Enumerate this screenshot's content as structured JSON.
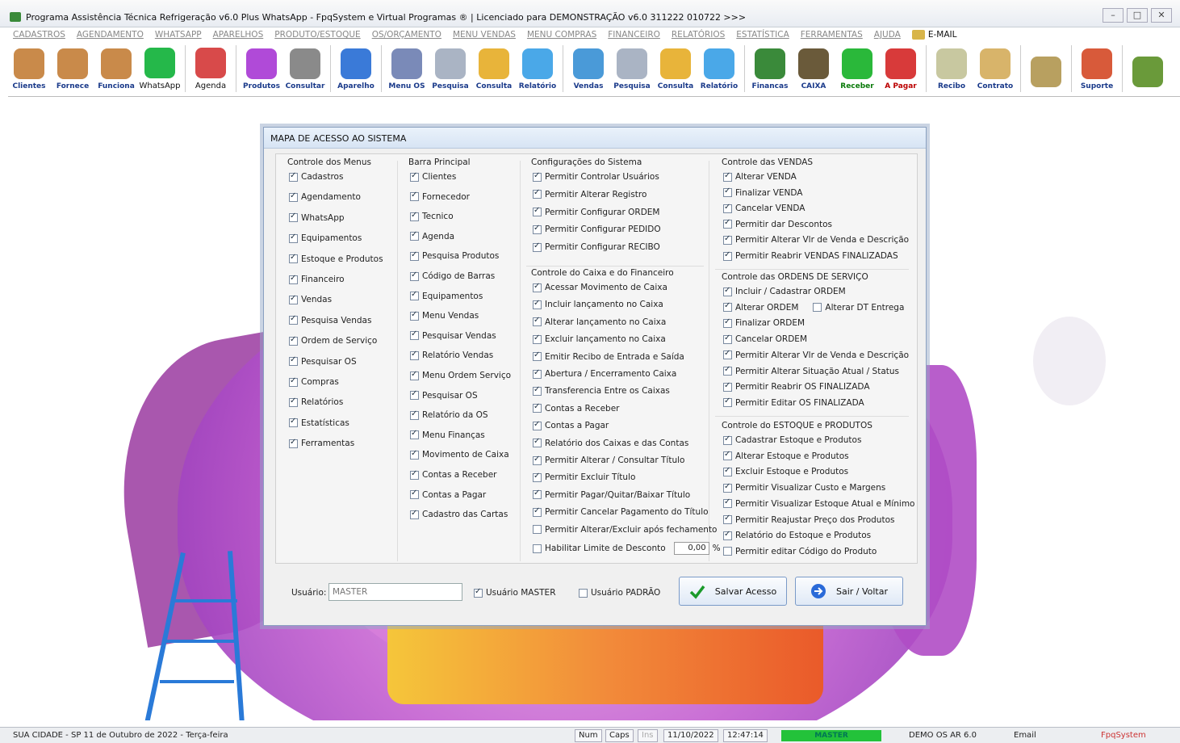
{
  "window": {
    "title": "Programa Assistência Técnica Refrigeração v6.0 Plus WhatsApp - FpqSystem e Virtual Programas ® | Licenciado para  DEMONSTRAÇÃO v6.0 311222 010722 >>>",
    "controls": [
      "–",
      "□",
      "✕"
    ]
  },
  "menu": [
    "CADASTROS",
    "AGENDAMENTO",
    "WHATSAPP",
    "APARELHOS",
    "PRODUTO/ESTOQUE",
    "OS/ORÇAMENTO",
    "MENU VENDAS",
    "MENU COMPRAS",
    "FINANCEIRO",
    "RELATÓRIOS",
    "ESTATÍSTICA",
    "FERRAMENTAS",
    "AJUDA"
  ],
  "menu_email": "E-MAIL",
  "toolbar": [
    {
      "label": "Clientes",
      "icon": "clients-icon",
      "color": "#c98a4a"
    },
    {
      "label": "Fornece",
      "icon": "supplier-icon",
      "color": "#c98a4a"
    },
    {
      "label": "Funciona",
      "icon": "employees-icon",
      "color": "#c98a4a"
    },
    {
      "label": "WhatsApp",
      "icon": "whatsapp-icon",
      "color": "#25b84a"
    },
    {
      "label": "Agenda",
      "icon": "calendar-icon",
      "color": "#d84a4a"
    },
    {
      "label": "Produtos",
      "icon": "products-icon",
      "color": "#b04ad8"
    },
    {
      "label": "Consultar",
      "icon": "barcode-icon",
      "color": "#8a8a8a"
    },
    {
      "label": "Aparelho",
      "icon": "device-icon",
      "color": "#3a7ad8"
    },
    {
      "label": "Menu OS",
      "icon": "tools-icon",
      "color": "#7a8ab8"
    },
    {
      "label": "Pesquisa",
      "icon": "search-doc-icon",
      "color": "#aab4c4"
    },
    {
      "label": "Consulta",
      "icon": "folder-icon",
      "color": "#e8b43a"
    },
    {
      "label": "Relatório",
      "icon": "report-icon",
      "color": "#4aa8e8"
    },
    {
      "label": "Vendas",
      "icon": "monitor-icon",
      "color": "#4a9ad8"
    },
    {
      "label": "Pesquisa",
      "icon": "search-doc-icon",
      "color": "#aab4c4"
    },
    {
      "label": "Consulta",
      "icon": "folder-icon",
      "color": "#e8b43a"
    },
    {
      "label": "Relatório",
      "icon": "report-icon",
      "color": "#4aa8e8"
    },
    {
      "label": "Financas",
      "icon": "finance-icon",
      "color": "#3a8a3a"
    },
    {
      "label": "CAIXA",
      "icon": "cashbox-icon",
      "color": "#6a5a3a"
    },
    {
      "label": "Receber",
      "icon": "receive-icon",
      "color": "#2ab83a"
    },
    {
      "label": "A Pagar",
      "icon": "pay-icon",
      "color": "#d83a3a"
    },
    {
      "label": "Recibo",
      "icon": "receipt-icon",
      "color": "#c8c8a0"
    },
    {
      "label": "Contrato",
      "icon": "contract-icon",
      "color": "#d8b46a"
    },
    {
      "label": "",
      "icon": "coins-icon",
      "color": "#b8a060"
    },
    {
      "label": "Suporte",
      "icon": "support-icon",
      "color": "#d85a3a"
    },
    {
      "label": "",
      "icon": "exit-icon",
      "color": "#6a9a3a"
    }
  ],
  "dialog": {
    "title": "MAPA DE ACESSO AO SISTEMA",
    "menus": {
      "title": "Controle dos Menus",
      "items": [
        {
          "label": "Cadastros",
          "checked": true
        },
        {
          "label": "Agendamento",
          "checked": true
        },
        {
          "label": "WhatsApp",
          "checked": true
        },
        {
          "label": "Equipamentos",
          "checked": true
        },
        {
          "label": "Estoque e Produtos",
          "checked": true
        },
        {
          "label": "Financeiro",
          "checked": true
        },
        {
          "label": "Vendas",
          "checked": true
        },
        {
          "label": "Pesquisa Vendas",
          "checked": true
        },
        {
          "label": "Ordem de Serviço",
          "checked": true
        },
        {
          "label": "Pesquisar OS",
          "checked": true
        },
        {
          "label": "Compras",
          "checked": true
        },
        {
          "label": "Relatórios",
          "checked": true
        },
        {
          "label": "Estatísticas",
          "checked": true
        },
        {
          "label": "Ferramentas",
          "checked": true
        }
      ]
    },
    "barra": {
      "title": "Barra Principal",
      "items": [
        {
          "label": "Clientes",
          "checked": true
        },
        {
          "label": "Fornecedor",
          "checked": true
        },
        {
          "label": "Tecnico",
          "checked": true
        },
        {
          "label": "Agenda",
          "checked": true
        },
        {
          "label": "Pesquisa Produtos",
          "checked": true
        },
        {
          "label": "Código de Barras",
          "checked": true
        },
        {
          "label": "Equipamentos",
          "checked": true
        },
        {
          "label": "Menu Vendas",
          "checked": true
        },
        {
          "label": "Pesquisar Vendas",
          "checked": true
        },
        {
          "label": "Relatório Vendas",
          "checked": true
        },
        {
          "label": "Menu Ordem Serviço",
          "checked": true
        },
        {
          "label": "Pesquisar OS",
          "checked": true
        },
        {
          "label": "Relatório da OS",
          "checked": true
        },
        {
          "label": "Menu Finanças",
          "checked": true
        },
        {
          "label": "Movimento de Caixa",
          "checked": true
        },
        {
          "label": "Contas a Receber",
          "checked": true
        },
        {
          "label": "Contas a Pagar",
          "checked": true
        },
        {
          "label": "Cadastro das Cartas",
          "checked": true
        }
      ]
    },
    "config": {
      "title": "Configurações do Sistema",
      "items": [
        {
          "label": "Permitir Controlar Usuários",
          "checked": true
        },
        {
          "label": "Permitir Alterar Registro",
          "checked": true
        },
        {
          "label": "Permitir Configurar ORDEM",
          "checked": true
        },
        {
          "label": "Permitir Configurar PEDIDO",
          "checked": true
        },
        {
          "label": "Permitir Configurar RECIBO",
          "checked": true
        }
      ]
    },
    "caixa": {
      "title": "Controle do Caixa e do Financeiro",
      "items": [
        {
          "label": "Acessar Movimento de Caixa",
          "checked": true
        },
        {
          "label": "Incluir lançamento no Caixa",
          "checked": true
        },
        {
          "label": "Alterar lançamento no Caixa",
          "checked": true
        },
        {
          "label": "Excluir lançamento no Caixa",
          "checked": true
        },
        {
          "label": "Emitir Recibo de Entrada e Saída",
          "checked": true
        },
        {
          "label": "Abertura / Encerramento Caixa",
          "checked": true
        },
        {
          "label": "Transferencia Entre os Caixas",
          "checked": true
        },
        {
          "label": "Contas a Receber",
          "checked": true
        },
        {
          "label": "Contas a Pagar",
          "checked": true
        },
        {
          "label": "Relatório dos Caixas e das Contas",
          "checked": true
        },
        {
          "label": "Permitir Alterar / Consultar Título",
          "checked": true
        },
        {
          "label": "Permitir Excluir Título",
          "checked": true
        },
        {
          "label": "Permitir Pagar/Quitar/Baixar Título",
          "checked": true
        },
        {
          "label": "Permitir Cancelar Pagamento do Título",
          "checked": true
        },
        {
          "label": "Permitir Alterar/Excluir após fechamento",
          "checked": false
        },
        {
          "label": "Habilitar Limite de Desconto",
          "checked": false
        }
      ],
      "desconto_value": "0,00",
      "desconto_unit": "%"
    },
    "vendas": {
      "title": "Controle das VENDAS",
      "items": [
        {
          "label": "Alterar VENDA",
          "checked": true
        },
        {
          "label": "Finalizar VENDA",
          "checked": true
        },
        {
          "label": "Cancelar VENDA",
          "checked": true
        },
        {
          "label": "Permitir dar Descontos",
          "checked": true
        },
        {
          "label": "Permitir Alterar Vlr de Venda e Descrição",
          "checked": true
        },
        {
          "label": "Permitir Reabrir VENDAS FINALIZADAS",
          "checked": true
        }
      ]
    },
    "ordens": {
      "title": "Controle das ORDENS DE SERVIÇO",
      "items": [
        {
          "label": "Incluir / Cadastrar ORDEM",
          "checked": true
        },
        {
          "label": "Alterar ORDEM",
          "checked": true
        },
        {
          "label": "Finalizar ORDEM",
          "checked": true
        },
        {
          "label": "Cancelar ORDEM",
          "checked": true
        },
        {
          "label": "Permitir Alterar Vlr de Venda e Descrição",
          "checked": true
        },
        {
          "label": "Permitir Alterar Situação Atual / Status",
          "checked": true
        },
        {
          "label": "Permitir Reabrir OS FINALIZADA",
          "checked": true
        },
        {
          "label": "Permitir Editar OS FINALIZADA",
          "checked": true
        }
      ],
      "extra": {
        "label": "Alterar DT Entrega",
        "checked": false
      }
    },
    "estoque": {
      "title": "Controle do ESTOQUE e PRODUTOS",
      "items": [
        {
          "label": "Cadastrar Estoque e Produtos",
          "checked": true
        },
        {
          "label": "Alterar Estoque e Produtos",
          "checked": true
        },
        {
          "label": "Excluir Estoque e Produtos",
          "checked": true
        },
        {
          "label": "Permitir Visualizar Custo e Margens",
          "checked": true
        },
        {
          "label": "Permitir Visualizar Estoque Atual e Mínimo",
          "checked": true
        },
        {
          "label": "Permitir Reajustar Preço dos Produtos",
          "checked": true
        },
        {
          "label": "Relatório do Estoque e Produtos",
          "checked": true
        },
        {
          "label": "Permitir editar Código do Produto",
          "checked": false
        }
      ]
    },
    "user_label": "Usuário:",
    "user_value": "MASTER",
    "usuario_master": {
      "label": "Usuário MASTER",
      "checked": true
    },
    "usuario_padrao": {
      "label": "Usuário PADRÃO",
      "checked": false
    },
    "save_label": "Salvar Acesso",
    "exit_label": "Sair / Voltar"
  },
  "statusbar": {
    "location": "SUA CIDADE - SP 11 de Outubro de 2022 - Terça-feira",
    "num": "Num",
    "caps": "Caps",
    "ins": "Ins",
    "date": "11/10/2022",
    "time": "12:47:14",
    "user": "MASTER",
    "version": "DEMO OS AR 6.0",
    "email": "Email",
    "brand": "FpqSystem"
  }
}
